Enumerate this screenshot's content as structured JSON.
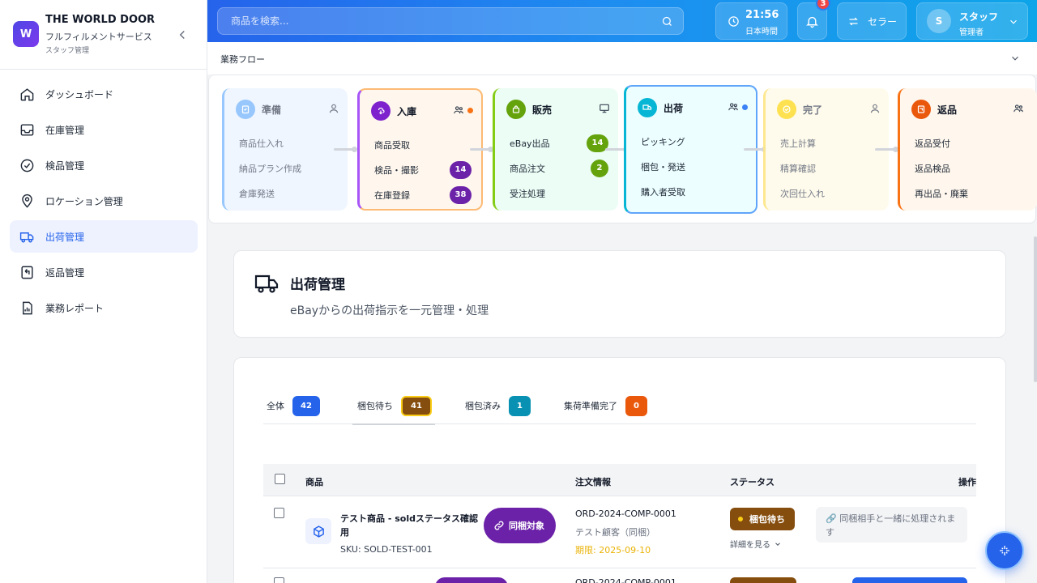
{
  "brand": {
    "logo_letter": "W",
    "title": "THE WORLD DOOR",
    "subtitle": "フルフィルメントサービス",
    "role": "スタッフ管理"
  },
  "nav": [
    {
      "label": "ダッシュボード",
      "icon": "home-icon",
      "active": false
    },
    {
      "label": "在庫管理",
      "icon": "inbox-icon",
      "active": false
    },
    {
      "label": "検品管理",
      "icon": "check-circle-icon",
      "active": false
    },
    {
      "label": "ロケーション管理",
      "icon": "map-pin-icon",
      "active": false
    },
    {
      "label": "出荷管理",
      "icon": "truck-icon",
      "active": true
    },
    {
      "label": "返品管理",
      "icon": "return-icon",
      "active": false
    },
    {
      "label": "業務レポート",
      "icon": "report-icon",
      "active": false
    }
  ],
  "topbar": {
    "search_placeholder": "商品を検索...",
    "time": "21:56",
    "timezone": "日本時間",
    "notification_count": "3",
    "seller_label": "セラー",
    "user_initial": "S",
    "user_name": "スタッフ",
    "user_role": "管理者"
  },
  "flow": {
    "title": "業務フロー",
    "cards": [
      {
        "title": "準備",
        "items": [
          {
            "label": "商品仕入れ"
          },
          {
            "label": "納品プラン作成"
          },
          {
            "label": "倉庫発送"
          }
        ]
      },
      {
        "title": "入庫",
        "items": [
          {
            "label": "商品受取"
          },
          {
            "label": "検品・撮影",
            "count": "14"
          },
          {
            "label": "在庫登録",
            "count": "38"
          }
        ]
      },
      {
        "title": "販売",
        "items": [
          {
            "label": "eBay出品",
            "count": "14"
          },
          {
            "label": "商品注文",
            "count": "2"
          },
          {
            "label": "受注処理"
          }
        ]
      },
      {
        "title": "出荷",
        "items": [
          {
            "label": "ピッキング"
          },
          {
            "label": "梱包・発送"
          },
          {
            "label": "購入者受取"
          }
        ]
      },
      {
        "title": "完了",
        "items": [
          {
            "label": "売上計算"
          },
          {
            "label": "精算確認"
          },
          {
            "label": "次回仕入れ"
          }
        ]
      },
      {
        "title": "返品",
        "items": [
          {
            "label": "返品受付"
          },
          {
            "label": "返品検品"
          },
          {
            "label": "再出品・廃棄"
          }
        ]
      }
    ]
  },
  "page": {
    "title": "出荷管理",
    "subtitle": "eBayからの出荷指示を一元管理・処理"
  },
  "tabs": [
    {
      "label": "全体",
      "count": "42",
      "color": "#2563eb"
    },
    {
      "label": "梱包待ち",
      "count": "41",
      "color": "#854d0e"
    },
    {
      "label": "梱包済み",
      "count": "1",
      "color": "#0891b2"
    },
    {
      "label": "集荷準備完了",
      "count": "0",
      "color": "#ea580c"
    }
  ],
  "table": {
    "headers": {
      "product": "商品",
      "order": "注文情報",
      "status": "ステータス",
      "actions": "操作"
    },
    "rows": [
      {
        "name": "テスト商品 - soldステータス確認用",
        "sku": "SKU: SOLD-TEST-001",
        "bundle": "同梱対象",
        "order_id": "ORD-2024-COMP-0001",
        "customer": "テスト顧客（同梱）",
        "due": "期限: 2025-09-10",
        "status": "梱包待ち",
        "detail": "詳細を見る",
        "action_note": "同梱相手と一緒に処理されます"
      },
      {
        "order_id": "ORD-2024-COMP-0001"
      }
    ]
  }
}
